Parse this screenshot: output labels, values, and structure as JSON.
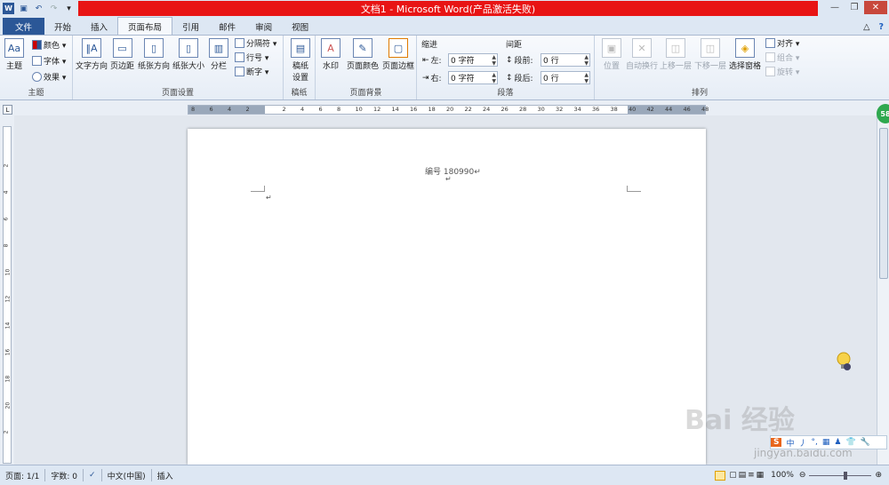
{
  "window": {
    "title": "文档1 - Microsoft Word(产品激活失败)",
    "minimize": "—",
    "restore": "❐",
    "close": "✕",
    "help": "?",
    "collapse": "△"
  },
  "quick_access": {
    "app_icon": "word-icon",
    "save_icon": "save-icon",
    "undo_icon": "undo-icon",
    "redo_icon": "redo-icon",
    "customize_icon": "dropdown-icon"
  },
  "tabs": [
    "文件",
    "开始",
    "插入",
    "页面布局",
    "引用",
    "邮件",
    "审阅",
    "视图"
  ],
  "active_tab": "页面布局",
  "ribbon": {
    "theme_group": {
      "label": "主题",
      "theme_btn": "主题",
      "colors": "颜色 ▾",
      "fonts": "字体 ▾",
      "effects": "效果 ▾"
    },
    "page_setup": {
      "label": "页面设置",
      "text_direction": "文字方向",
      "margins": "页边距",
      "orientation": "纸张方向",
      "size": "纸张大小",
      "columns": "分栏",
      "breaks": "分隔符 ▾",
      "line_numbers": "行号 ▾",
      "hyphenation": "断字 ▾"
    },
    "draft": {
      "label": "稿纸",
      "btn_line1": "稿纸",
      "btn_line2": "设置"
    },
    "page_background": {
      "label": "页面背景",
      "watermark": "水印",
      "page_color": "页面颜色",
      "page_border": "页面边框"
    },
    "paragraph": {
      "label": "段落",
      "indent_heading": "缩进",
      "left_label": "左:",
      "left_value": "0 字符",
      "right_label": "右:",
      "right_value": "0 字符",
      "spacing_heading": "间距",
      "before_label": "段前:",
      "before_value": "0 行",
      "after_label": "段后:",
      "after_value": "0 行"
    },
    "arrange": {
      "label": "排列",
      "position": "位置",
      "wrap_text": "自动换行",
      "bring_forward": "上移一层",
      "send_backward": "下移一层",
      "selection_pane": "选择窗格",
      "align": "对齐 ▾",
      "group": "组合 ▾",
      "rotate": "旋转 ▾"
    }
  },
  "ruler": {
    "h_ticks": [
      "8",
      "6",
      "4",
      "2",
      "",
      "2",
      "4",
      "6",
      "8",
      "10",
      "12",
      "14",
      "16",
      "18",
      "20",
      "22",
      "24",
      "26",
      "28",
      "30",
      "32",
      "34",
      "36",
      "38",
      "40",
      "42",
      "44",
      "46",
      "48"
    ],
    "v_ticks": [
      "2",
      "4",
      "6",
      "8",
      "10",
      "12",
      "14",
      "16",
      "18",
      "20",
      "2"
    ]
  },
  "document": {
    "header_text": "编号 180990",
    "para_mark": "↵"
  },
  "status": {
    "page": "页面: 1/1",
    "words": "字数: 0",
    "language": "中文(中国)",
    "insert_mode": "插入",
    "zoom": "100%"
  },
  "ime": {
    "items": [
      "中",
      "丿",
      "°,",
      "▦",
      "♟",
      "👕",
      "🔧"
    ]
  },
  "watermark": {
    "text": "Bai 经验",
    "url": "jingyan.baidu.com"
  },
  "badge": "58"
}
